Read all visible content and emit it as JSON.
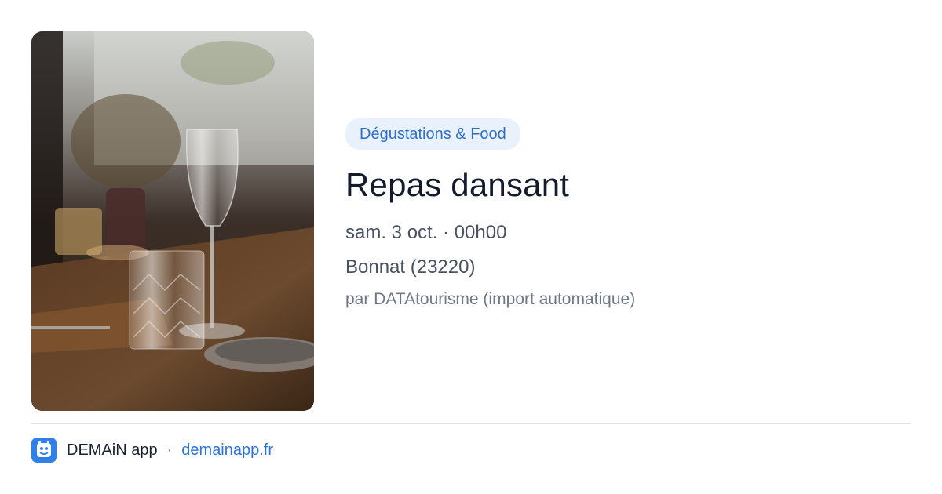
{
  "event": {
    "category": "Dégustations & Food",
    "title": "Repas dansant",
    "date": "sam. 3 oct. · 00h00",
    "location": "Bonnat (23220)",
    "source": "par DATAtourisme (import automatique)",
    "image_alt": "Table de restaurant dressée avec verres en cristal"
  },
  "footer": {
    "app_name": "DEMAiN app",
    "separator": "·",
    "url": "demainapp.fr",
    "logo_icon": "demain-logo-icon"
  },
  "colors": {
    "tag_bg": "#e9f2fc",
    "tag_text": "#2f6fc9",
    "title": "#141c2c",
    "link": "#2f74d0",
    "logo": "#2f80e8"
  }
}
